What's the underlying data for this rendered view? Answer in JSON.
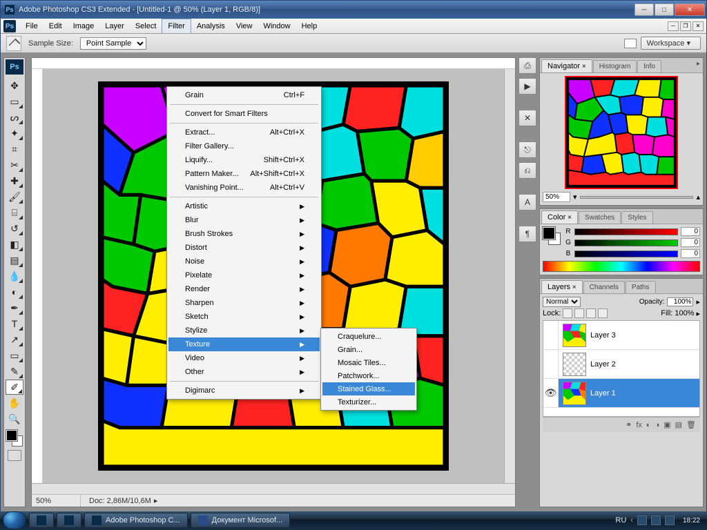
{
  "window": {
    "title_main": "Adobe Photoshop CS3 Extended - [Untitled-1 @ 50% (Layer 1, RGB/8)]"
  },
  "menubar": {
    "items": [
      "File",
      "Edit",
      "Image",
      "Layer",
      "Select",
      "Filter",
      "Analysis",
      "View",
      "Window",
      "Help"
    ],
    "open_index": 5
  },
  "options": {
    "sample_label": "Sample Size:",
    "sample_value": "Point Sample",
    "workspace_label": "Workspace"
  },
  "filter_menu": {
    "last": {
      "name": "Grain",
      "shortcut": "Ctrl+F"
    },
    "smart": "Convert for Smart Filters",
    "group1": [
      {
        "name": "Extract...",
        "shortcut": "Alt+Ctrl+X"
      },
      {
        "name": "Filter Gallery...",
        "shortcut": ""
      },
      {
        "name": "Liquify...",
        "shortcut": "Shift+Ctrl+X"
      },
      {
        "name": "Pattern Maker...",
        "shortcut": "Alt+Shift+Ctrl+X"
      },
      {
        "name": "Vanishing Point...",
        "shortcut": "Alt+Ctrl+V"
      }
    ],
    "categories": [
      "Artistic",
      "Blur",
      "Brush Strokes",
      "Distort",
      "Noise",
      "Pixelate",
      "Render",
      "Sharpen",
      "Sketch",
      "Stylize",
      "Texture",
      "Video",
      "Other"
    ],
    "hl_index": 10,
    "last_group": "Digimarc"
  },
  "texture_submenu": {
    "items": [
      "Craquelure...",
      "Grain...",
      "Mosaic Tiles...",
      "Patchwork...",
      "Stained Glass...",
      "Texturizer..."
    ],
    "hl_index": 4
  },
  "navigator": {
    "tabs": [
      "Navigator",
      "Histogram",
      "Info"
    ],
    "zoom": "50%"
  },
  "color": {
    "tabs": [
      "Color",
      "Swatches",
      "Styles"
    ],
    "r": {
      "label": "R",
      "value": "0"
    },
    "g": {
      "label": "G",
      "value": "0"
    },
    "b": {
      "label": "B",
      "value": "0"
    }
  },
  "layers": {
    "tabs": [
      "Layers",
      "Channels",
      "Paths"
    ],
    "blend": "Normal",
    "opacity_label": "Opacity:",
    "opacity": "100%",
    "lock_label": "Lock:",
    "fill_label": "Fill:",
    "fill": "100%",
    "list": [
      {
        "name": "Layer 3",
        "visible": false,
        "art": true
      },
      {
        "name": "Layer 2",
        "visible": false,
        "art": false
      },
      {
        "name": "Layer 1",
        "visible": true,
        "art": true,
        "selected": true
      }
    ]
  },
  "tools": [
    "move",
    "marquee",
    "lasso",
    "wand",
    "crop",
    "slice",
    "heal",
    "brush",
    "stamp",
    "history",
    "eraser",
    "gradient",
    "blur",
    "dodge",
    "pen",
    "type",
    "path",
    "rect",
    "notes",
    "eyedrop",
    "hand",
    "zoom"
  ],
  "canvas": {
    "zoom": "50%",
    "doc": "Doc: 2,86M/10,6M"
  },
  "taskbar": {
    "apps": [
      "Adobe Photoshop C...",
      "Документ Microsof..."
    ],
    "lang": "RU",
    "clock": "18:22"
  }
}
